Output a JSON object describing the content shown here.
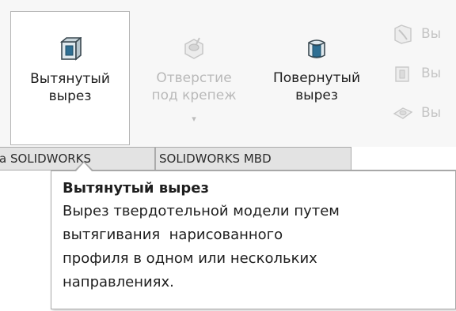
{
  "ribbon": {
    "extrude_cut": {
      "line1": "Вытянутый",
      "line2": "вырез",
      "icon": "extruded-cut-icon"
    },
    "hole_wizard": {
      "line1": "Отверстие",
      "line2": "под крепеж",
      "arrow": "▾",
      "icon": "hole-wizard-icon"
    },
    "revolve_cut": {
      "line1": "Повернутый",
      "line2": "вырез",
      "icon": "revolved-cut-icon"
    },
    "side_items": [
      {
        "label": "Вы",
        "icon": "swept-cut-icon"
      },
      {
        "label": "Вы",
        "icon": "lofted-cut-icon"
      },
      {
        "label": "Вы",
        "icon": "boundary-cut-icon"
      }
    ]
  },
  "tabs": [
    {
      "label": "а SOLIDWORKS"
    },
    {
      "label": "SOLIDWORKS MBD"
    }
  ],
  "tooltip": {
    "title": "Вытянутый вырез",
    "lines": [
      "Вырез твердотельной модели путем",
      "вытягивания  нарисованного",
      "профиля в одном или нескольких",
      "направлениях."
    ]
  },
  "colors": {
    "ribbon_bg": "#f7f7f7",
    "disabled_text": "#b9b9b9",
    "icon_blue": "#2f6f93",
    "tab_bg": "#e3e3e3"
  }
}
